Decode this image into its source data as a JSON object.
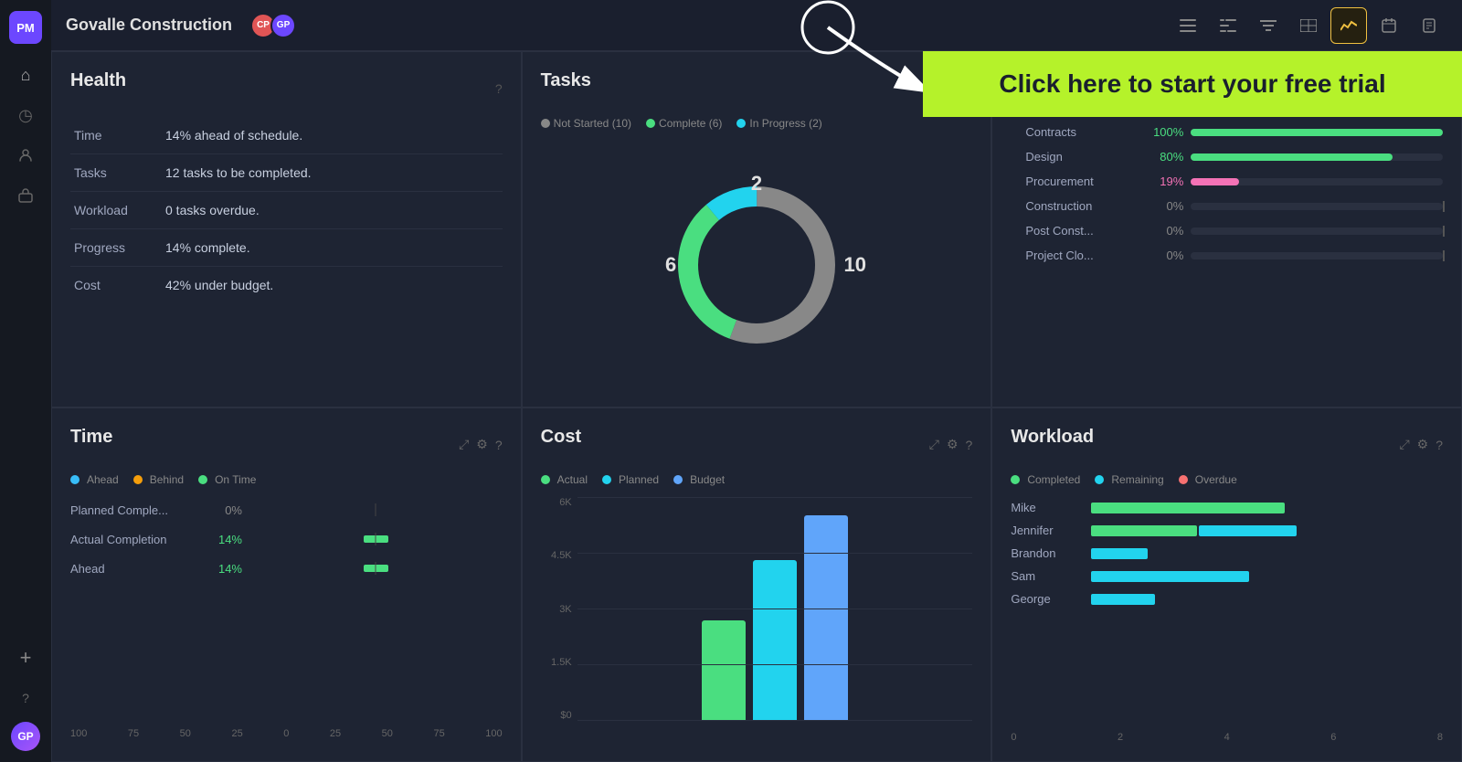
{
  "app": {
    "logo": "PM",
    "title": "Govalle Construction"
  },
  "sidebar": {
    "icons": [
      {
        "name": "home-icon",
        "symbol": "⌂",
        "active": false
      },
      {
        "name": "clock-icon",
        "symbol": "◷",
        "active": false
      },
      {
        "name": "people-icon",
        "symbol": "👤",
        "active": false
      },
      {
        "name": "briefcase-icon",
        "symbol": "💼",
        "active": false
      }
    ],
    "bottom_icons": [
      {
        "name": "add-icon",
        "symbol": "+"
      },
      {
        "name": "help-icon",
        "symbol": "?"
      }
    ]
  },
  "topbar": {
    "title": "Govalle Construction",
    "avatars": [
      {
        "initials": "CP",
        "color": "#e05555"
      },
      {
        "initials": "GP",
        "color": "#6c47ff"
      }
    ],
    "toolbar_icons": [
      {
        "name": "list-icon",
        "symbol": "≡",
        "active": false
      },
      {
        "name": "gantt-icon",
        "symbol": "▦",
        "active": false
      },
      {
        "name": "filter-icon",
        "symbol": "⊟",
        "active": false
      },
      {
        "name": "table-icon",
        "symbol": "⊞",
        "active": false
      },
      {
        "name": "dashboard-icon",
        "symbol": "∿",
        "active": true
      },
      {
        "name": "calendar-icon",
        "symbol": "▦",
        "active": false
      },
      {
        "name": "doc-icon",
        "symbol": "📄",
        "active": false
      }
    ]
  },
  "free_trial": {
    "text": "Click here to start your free trial"
  },
  "health": {
    "title": "Health",
    "rows": [
      {
        "label": "Time",
        "value": "14% ahead of schedule."
      },
      {
        "label": "Tasks",
        "value": "12 tasks to be completed."
      },
      {
        "label": "Workload",
        "value": "0 tasks overdue."
      },
      {
        "label": "Progress",
        "value": "14% complete."
      },
      {
        "label": "Cost",
        "value": "42% under budget."
      }
    ]
  },
  "tasks": {
    "title": "Tasks",
    "legend": [
      {
        "label": "Not Started (10)",
        "color": "#888888"
      },
      {
        "label": "Complete (6)",
        "color": "#4ade80"
      },
      {
        "label": "In Progress (2)",
        "color": "#22d3ee"
      }
    ],
    "donut": {
      "not_started": 10,
      "complete": 6,
      "in_progress": 2,
      "label_left": "6",
      "label_right": "10",
      "label_top": "2"
    },
    "bars": [
      {
        "label": "Contracts",
        "pct": 100,
        "color": "#4ade80",
        "text": "100%"
      },
      {
        "label": "Design",
        "pct": 80,
        "color": "#4ade80",
        "text": "80%"
      },
      {
        "label": "Procurement",
        "pct": 19,
        "color": "#f472b6",
        "text": "19%"
      },
      {
        "label": "Construction",
        "pct": 0,
        "color": "#4ade80",
        "text": "0%"
      },
      {
        "label": "Post Const...",
        "pct": 0,
        "color": "#4ade80",
        "text": "0%"
      },
      {
        "label": "Project Clo...",
        "pct": 0,
        "color": "#4ade80",
        "text": "0%"
      }
    ]
  },
  "time": {
    "title": "Time",
    "legend": [
      {
        "label": "Ahead",
        "color": "#38bdf8"
      },
      {
        "label": "Behind",
        "color": "#f59e0b"
      },
      {
        "label": "On Time",
        "color": "#4ade80"
      }
    ],
    "rows": [
      {
        "label": "Planned Comple...",
        "pct_text": "0%",
        "pct": 0,
        "color": "#4ade80"
      },
      {
        "label": "Actual Completion",
        "pct_text": "14%",
        "pct": 14,
        "color": "#4ade80"
      },
      {
        "label": "Ahead",
        "pct_text": "14%",
        "pct": 14,
        "color": "#4ade80"
      }
    ],
    "xaxis": [
      "100",
      "75",
      "50",
      "25",
      "0",
      "25",
      "50",
      "75",
      "100"
    ]
  },
  "cost": {
    "title": "Cost",
    "legend": [
      {
        "label": "Actual",
        "color": "#4ade80"
      },
      {
        "label": "Planned",
        "color": "#22d3ee"
      },
      {
        "label": "Budget",
        "color": "#60a5fa"
      }
    ],
    "yaxis": [
      "6K",
      "4.5K",
      "3K",
      "1.5K",
      "$0"
    ],
    "bars": [
      {
        "actual": 45,
        "planned": 72,
        "budget": 95
      }
    ]
  },
  "workload": {
    "title": "Workload",
    "legend": [
      {
        "label": "Completed",
        "color": "#4ade80"
      },
      {
        "label": "Remaining",
        "color": "#22d3ee"
      },
      {
        "label": "Overdue",
        "color": "#f87171"
      }
    ],
    "people": [
      {
        "name": "Mike",
        "completed": 70,
        "remaining": 0,
        "overdue": 0
      },
      {
        "name": "Jennifer",
        "completed": 40,
        "remaining": 35,
        "overdue": 0
      },
      {
        "name": "Brandon",
        "completed": 0,
        "remaining": 20,
        "overdue": 0
      },
      {
        "name": "Sam",
        "completed": 0,
        "remaining": 55,
        "overdue": 0
      },
      {
        "name": "George",
        "completed": 0,
        "remaining": 22,
        "overdue": 0
      }
    ],
    "xaxis": [
      "0",
      "2",
      "4",
      "6",
      "8"
    ]
  }
}
